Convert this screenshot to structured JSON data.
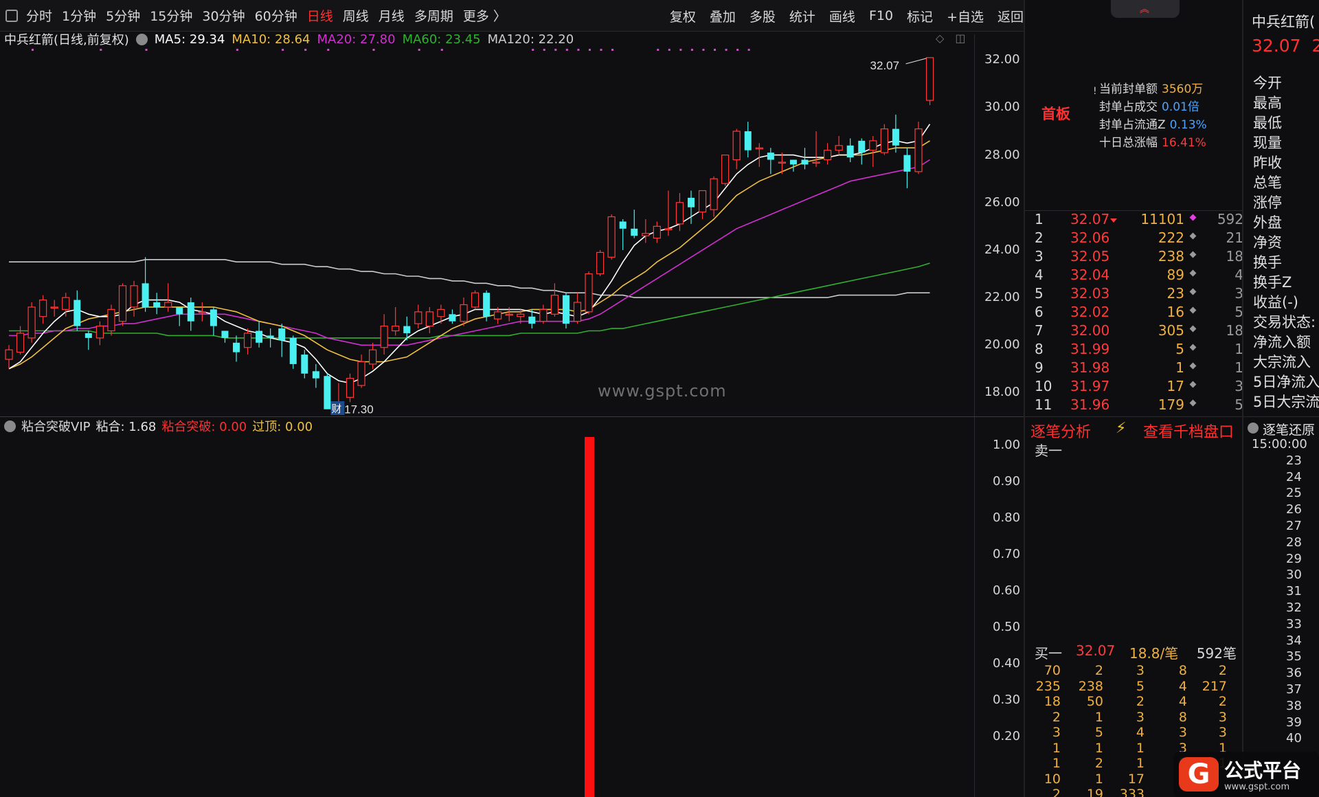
{
  "toolbar": {
    "periods": [
      "分时",
      "1分钟",
      "5分钟",
      "15分钟",
      "30分钟",
      "60分钟",
      "日线",
      "周线",
      "月线",
      "多周期",
      "更多 〉"
    ],
    "active_period": "日线",
    "right_tools": [
      "复权",
      "叠加",
      "多股",
      "统计",
      "画线",
      "F10",
      "标记",
      "+自选",
      "返回"
    ]
  },
  "legend": {
    "title": "中兵红箭(日线,前复权)",
    "ma5": "MA5: 29.34",
    "ma10": "MA10: 28.64",
    "ma20": "MA20: 27.80",
    "ma60": "MA60: 23.45",
    "ma120": "MA120: 22.20"
  },
  "price_axis": [
    "32.00",
    "30.00",
    "28.00",
    "26.00",
    "24.00",
    "22.00",
    "20.00",
    "18.00"
  ],
  "watermark": "www.gspt.com",
  "chart_data": {
    "type": "candlestick",
    "y_range": [
      17.0,
      32.5
    ],
    "candles": [
      [
        19.4,
        19.8,
        19.0,
        20.0
      ],
      [
        19.7,
        20.5,
        19.6,
        20.8
      ],
      [
        20.3,
        21.6,
        20.1,
        21.8
      ],
      [
        21.2,
        21.9,
        20.9,
        22.1
      ],
      [
        21.6,
        21.6,
        21.2,
        21.9
      ],
      [
        21.5,
        22.0,
        21.2,
        22.2
      ],
      [
        21.9,
        20.8,
        20.6,
        22.3
      ],
      [
        20.5,
        20.3,
        19.8,
        20.6
      ],
      [
        20.3,
        20.8,
        20.0,
        21.0
      ],
      [
        20.6,
        21.5,
        20.4,
        21.7
      ],
      [
        21.0,
        22.5,
        20.8,
        22.6
      ],
      [
        21.6,
        22.5,
        21.2,
        22.7
      ],
      [
        22.6,
        21.6,
        21.4,
        23.7
      ],
      [
        21.8,
        21.6,
        21.3,
        22.2
      ],
      [
        21.6,
        21.8,
        21.4,
        22.6
      ],
      [
        21.6,
        21.3,
        20.8,
        21.6
      ],
      [
        21.8,
        21.0,
        20.6,
        22.0
      ],
      [
        21.4,
        21.4,
        21.0,
        21.8
      ],
      [
        21.5,
        20.8,
        20.4,
        21.6
      ],
      [
        20.6,
        20.3,
        20.1,
        20.6
      ],
      [
        20.1,
        19.7,
        19.3,
        20.4
      ],
      [
        19.9,
        20.5,
        19.6,
        20.7
      ],
      [
        20.6,
        20.1,
        19.9,
        21.0
      ],
      [
        20.4,
        20.3,
        19.9,
        20.7
      ],
      [
        20.7,
        20.2,
        19.5,
        20.9
      ],
      [
        20.3,
        19.2,
        19.0,
        20.4
      ],
      [
        19.6,
        18.8,
        18.6,
        19.8
      ],
      [
        18.9,
        18.6,
        18.2,
        19.2
      ],
      [
        18.7,
        17.3,
        17.3,
        18.8
      ],
      [
        17.6,
        17.6,
        17.3,
        18.4
      ],
      [
        17.8,
        18.6,
        17.6,
        18.8
      ],
      [
        18.3,
        19.3,
        18.2,
        19.6
      ],
      [
        19.2,
        19.8,
        19.0,
        20.1
      ],
      [
        19.9,
        20.8,
        19.6,
        21.3
      ],
      [
        20.6,
        20.8,
        20.4,
        21.6
      ],
      [
        20.8,
        20.5,
        20.2,
        21.2
      ],
      [
        20.9,
        21.4,
        20.7,
        21.7
      ],
      [
        20.8,
        21.4,
        20.5,
        21.6
      ],
      [
        21.2,
        21.5,
        20.9,
        21.7
      ],
      [
        21.3,
        21.0,
        20.9,
        21.5
      ],
      [
        21.0,
        21.7,
        20.8,
        22.0
      ],
      [
        21.6,
        22.2,
        21.5,
        22.3
      ],
      [
        22.2,
        21.2,
        21.0,
        22.3
      ],
      [
        21.1,
        21.4,
        20.9,
        21.6
      ],
      [
        21.3,
        21.3,
        21.0,
        21.6
      ],
      [
        21.2,
        21.3,
        20.9,
        21.5
      ],
      [
        21.2,
        20.9,
        20.7,
        21.5
      ],
      [
        21.0,
        21.5,
        20.9,
        21.7
      ],
      [
        21.3,
        22.1,
        21.2,
        22.6
      ],
      [
        22.1,
        20.9,
        20.7,
        22.2
      ],
      [
        21.0,
        21.8,
        20.9,
        22.2
      ],
      [
        21.4,
        23.0,
        21.3,
        23.1
      ],
      [
        23.0,
        23.9,
        22.9,
        24.0
      ],
      [
        23.7,
        25.4,
        23.6,
        25.5
      ],
      [
        25.2,
        24.9,
        24.0,
        25.3
      ],
      [
        24.9,
        24.6,
        24.5,
        25.7
      ],
      [
        24.6,
        24.7,
        24.3,
        25.3
      ],
      [
        24.5,
        25.0,
        24.3,
        25.2
      ],
      [
        24.9,
        24.9,
        24.6,
        26.5
      ],
      [
        25.1,
        26.0,
        24.8,
        26.4
      ],
      [
        26.2,
        25.8,
        25.1,
        26.5
      ],
      [
        25.6,
        26.5,
        25.3,
        26.5
      ],
      [
        25.7,
        27.0,
        25.4,
        27.1
      ],
      [
        26.8,
        28.0,
        26.7,
        28.0
      ],
      [
        27.8,
        29.0,
        27.4,
        29.1
      ],
      [
        29.0,
        28.2,
        27.9,
        29.4
      ],
      [
        28.3,
        28.3,
        27.5,
        28.5
      ],
      [
        28.1,
        27.8,
        27.2,
        28.3
      ],
      [
        27.7,
        27.7,
        27.2,
        28.1
      ],
      [
        27.8,
        27.6,
        27.3,
        27.8
      ],
      [
        27.8,
        27.6,
        27.4,
        28.3
      ],
      [
        27.7,
        27.7,
        27.5,
        29.0
      ],
      [
        27.8,
        28.2,
        27.6,
        28.5
      ],
      [
        28.2,
        28.4,
        28.0,
        28.8
      ],
      [
        28.4,
        27.9,
        27.7,
        28.7
      ],
      [
        28.6,
        28.1,
        27.6,
        28.7
      ],
      [
        28.2,
        28.6,
        27.5,
        28.8
      ],
      [
        28.1,
        29.1,
        28.0,
        29.3
      ],
      [
        29.1,
        28.4,
        28.1,
        29.7
      ],
      [
        28.0,
        27.3,
        26.6,
        28.3
      ],
      [
        27.3,
        29.1,
        27.2,
        29.4
      ],
      [
        30.3,
        32.1,
        30.1,
        32.1
      ]
    ],
    "ma5": [
      19.0,
      19.3,
      19.9,
      20.5,
      21.0,
      21.4,
      21.5,
      21.3,
      21.2,
      21.2,
      21.3,
      21.7,
      21.9,
      21.9,
      21.9,
      21.8,
      21.5,
      21.4,
      21.3,
      21.0,
      20.8,
      20.6,
      20.5,
      20.3,
      20.2,
      20.1,
      19.9,
      19.4,
      18.8,
      18.5,
      18.4,
      18.6,
      18.9,
      19.3,
      19.8,
      20.3,
      20.6,
      20.8,
      21.0,
      21.2,
      21.3,
      21.5,
      21.5,
      21.5,
      21.5,
      21.5,
      21.4,
      21.3,
      21.4,
      21.3,
      21.2,
      21.4,
      22.0,
      22.7,
      23.5,
      24.2,
      24.6,
      24.8,
      24.9,
      25.1,
      25.4,
      25.7,
      26.0,
      26.6,
      27.2,
      27.6,
      27.9,
      28.0,
      28.0,
      28.0,
      27.9,
      27.9,
      27.9,
      28.0,
      28.0,
      28.1,
      28.3,
      28.5,
      28.6,
      28.5,
      28.6,
      29.3
    ],
    "ma10": [
      19.0,
      19.2,
      19.5,
      19.9,
      20.3,
      20.7,
      20.9,
      21.1,
      21.2,
      21.3,
      21.4,
      21.5,
      21.6,
      21.6,
      21.6,
      21.6,
      21.6,
      21.6,
      21.6,
      21.5,
      21.4,
      21.2,
      21.0,
      20.9,
      20.8,
      20.6,
      20.4,
      20.1,
      19.8,
      19.6,
      19.4,
      19.3,
      19.3,
      19.3,
      19.4,
      19.5,
      19.8,
      20.1,
      20.4,
      20.7,
      20.9,
      21.1,
      21.2,
      21.3,
      21.4,
      21.4,
      21.5,
      21.5,
      21.5,
      21.5,
      21.4,
      21.5,
      21.8,
      22.1,
      22.5,
      22.8,
      23.1,
      23.5,
      23.8,
      24.1,
      24.5,
      24.9,
      25.3,
      25.8,
      26.3,
      26.6,
      26.9,
      27.1,
      27.3,
      27.5,
      27.7,
      27.8,
      27.9,
      28.0,
      28.0,
      28.0,
      28.1,
      28.2,
      28.3,
      28.3,
      28.3,
      28.6
    ],
    "ma20": [
      20.4,
      20.4,
      20.5,
      20.5,
      20.6,
      20.6,
      20.7,
      20.7,
      20.8,
      20.8,
      20.9,
      20.9,
      21.0,
      21.1,
      21.2,
      21.3,
      21.3,
      21.3,
      21.3,
      21.3,
      21.2,
      21.1,
      21.0,
      20.9,
      20.8,
      20.7,
      20.6,
      20.5,
      20.3,
      20.2,
      20.1,
      20.0,
      20.0,
      20.0,
      20.0,
      20.0,
      20.1,
      20.2,
      20.3,
      20.4,
      20.5,
      20.6,
      20.7,
      20.8,
      20.9,
      21.0,
      21.0,
      21.0,
      21.0,
      21.0,
      21.0,
      21.1,
      21.3,
      21.6,
      21.9,
      22.2,
      22.5,
      22.8,
      23.1,
      23.4,
      23.7,
      24.0,
      24.3,
      24.6,
      24.9,
      25.1,
      25.3,
      25.5,
      25.7,
      25.9,
      26.1,
      26.3,
      26.5,
      26.7,
      26.9,
      27.0,
      27.1,
      27.2,
      27.3,
      27.4,
      27.5,
      27.8
    ],
    "ma60": [
      20.6,
      20.6,
      20.6,
      20.6,
      20.6,
      20.6,
      20.6,
      20.6,
      20.5,
      20.5,
      20.5,
      20.5,
      20.5,
      20.5,
      20.4,
      20.4,
      20.4,
      20.4,
      20.4,
      20.3,
      20.3,
      20.3,
      20.3,
      20.3,
      20.3,
      20.3,
      20.3,
      20.3,
      20.3,
      20.3,
      20.3,
      20.3,
      20.3,
      20.3,
      20.3,
      20.3,
      20.3,
      20.3,
      20.4,
      20.4,
      20.4,
      20.4,
      20.4,
      20.4,
      20.4,
      20.5,
      20.5,
      20.5,
      20.5,
      20.5,
      20.5,
      20.6,
      20.6,
      20.7,
      20.7,
      20.8,
      20.9,
      21.0,
      21.1,
      21.2,
      21.3,
      21.4,
      21.5,
      21.6,
      21.7,
      21.8,
      21.9,
      22.0,
      22.1,
      22.2,
      22.3,
      22.4,
      22.5,
      22.6,
      22.7,
      22.8,
      22.9,
      23.0,
      23.1,
      23.2,
      23.3,
      23.45
    ],
    "ma120": [
      23.5,
      23.5,
      23.5,
      23.5,
      23.5,
      23.5,
      23.5,
      23.5,
      23.5,
      23.5,
      23.5,
      23.5,
      23.6,
      23.6,
      23.6,
      23.6,
      23.6,
      23.6,
      23.6,
      23.6,
      23.5,
      23.5,
      23.5,
      23.5,
      23.4,
      23.4,
      23.4,
      23.3,
      23.3,
      23.2,
      23.2,
      23.1,
      23.1,
      23.0,
      23.0,
      22.9,
      22.9,
      22.8,
      22.8,
      22.7,
      22.7,
      22.6,
      22.6,
      22.5,
      22.5,
      22.4,
      22.4,
      22.3,
      22.3,
      22.2,
      22.2,
      22.2,
      22.1,
      22.1,
      22.1,
      22.0,
      22.0,
      22.0,
      22.0,
      22.0,
      22.0,
      22.0,
      22.0,
      22.0,
      22.0,
      22.0,
      22.0,
      22.0,
      22.0,
      22.0,
      22.0,
      22.0,
      22.0,
      22.1,
      22.1,
      22.1,
      22.1,
      22.1,
      22.1,
      22.2,
      22.2,
      22.2
    ],
    "high_label": "32.07",
    "low_label": "17.30",
    "event_marker": "财"
  },
  "sub_chart": {
    "legend_name": "粘合突破VIP",
    "nianhe": "粘合: 1.68",
    "breakout": "粘合突破: 0.00",
    "guoding": "过顶: 0.00",
    "axis": [
      "1.00",
      "0.90",
      "0.80",
      "0.70",
      "0.60",
      "0.50",
      "0.40",
      "0.30",
      "0.20"
    ],
    "y_range": [
      0,
      1.0
    ],
    "signal_bar_index": 51,
    "signal_value": 1.0
  },
  "mid": {
    "badge": "首板",
    "seal_amount_label": "当前封单额",
    "seal_amount": "3560万",
    "seal_vol_label": "封单占成交",
    "seal_vol": "0.01倍",
    "seal_float_label": "封单占流通Z",
    "seal_float": "0.13%",
    "ten_day_label": "十日总涨幅",
    "ten_day": "16.41%",
    "book": [
      {
        "lvl": "1",
        "px": "32.07",
        "vol": "11101",
        "cnt": "592"
      },
      {
        "lvl": "2",
        "px": "32.06",
        "vol": "222",
        "cnt": "21"
      },
      {
        "lvl": "3",
        "px": "32.05",
        "vol": "238",
        "cnt": "18"
      },
      {
        "lvl": "4",
        "px": "32.04",
        "vol": "89",
        "cnt": "4"
      },
      {
        "lvl": "5",
        "px": "32.03",
        "vol": "23",
        "cnt": "3"
      },
      {
        "lvl": "6",
        "px": "32.02",
        "vol": "16",
        "cnt": "5"
      },
      {
        "lvl": "7",
        "px": "32.00",
        "vol": "305",
        "cnt": "18"
      },
      {
        "lvl": "8",
        "px": "31.99",
        "vol": "5",
        "cnt": "1"
      },
      {
        "lvl": "9",
        "px": "31.98",
        "vol": "1",
        "cnt": "1"
      },
      {
        "lvl": "10",
        "px": "31.97",
        "vol": "17",
        "cnt": "3"
      },
      {
        "lvl": "11",
        "px": "31.96",
        "vol": "179",
        "cnt": "5"
      }
    ],
    "tick_analysis": "逐笔分析",
    "view_depth": "查看千档盘口",
    "sell1": "卖一",
    "buy1_label": "买一",
    "buy1_price": "32.07",
    "buy1_avg": "18.8/笔",
    "buy1_count": "592笔",
    "queue": [
      [
        "70",
        "2",
        "3",
        "8",
        "2"
      ],
      [
        "235",
        "238",
        "5",
        "4",
        "217"
      ],
      [
        "18",
        "50",
        "2",
        "4",
        "2"
      ],
      [
        "2",
        "1",
        "3",
        "8",
        "3"
      ],
      [
        "3",
        "5",
        "4",
        "3",
        "3"
      ],
      [
        "1",
        "1",
        "1",
        "3",
        "1"
      ],
      [
        "1",
        "2",
        "1",
        "3",
        "1"
      ],
      [
        "10",
        "1",
        "17",
        "1",
        ""
      ],
      [
        "2",
        "19",
        "333",
        "",
        ""
      ]
    ]
  },
  "right": {
    "name": "中兵红箭(",
    "price": "32.07",
    "price_pct": "2.",
    "stats": [
      "今开",
      "最高",
      "最低",
      "现量",
      "昨收",
      "总笔",
      "涨停",
      "外盘",
      "净资",
      "换手",
      "换手Z",
      "收益(-)",
      "交易状态:",
      "净流入额",
      "大宗流入",
      "5日净流入",
      "5日大宗流"
    ],
    "tick_restore": "逐笔还原",
    "times": [
      "15:00:00",
      "23",
      "24",
      "25",
      "26",
      "27",
      "28",
      "29",
      "30",
      "31",
      "32",
      "33",
      "34",
      "35",
      "36",
      "37",
      "38",
      "39",
      "40"
    ]
  },
  "logo": {
    "title": "公式平台",
    "url": "www.gspt.com"
  },
  "colors": {
    "up": "#ff3a3a",
    "down": "#4af0f0",
    "ma5": "#ffffff",
    "ma10": "#f0c040",
    "ma20": "#d030d0",
    "ma60": "#30b030",
    "ma120": "#cccccc"
  }
}
